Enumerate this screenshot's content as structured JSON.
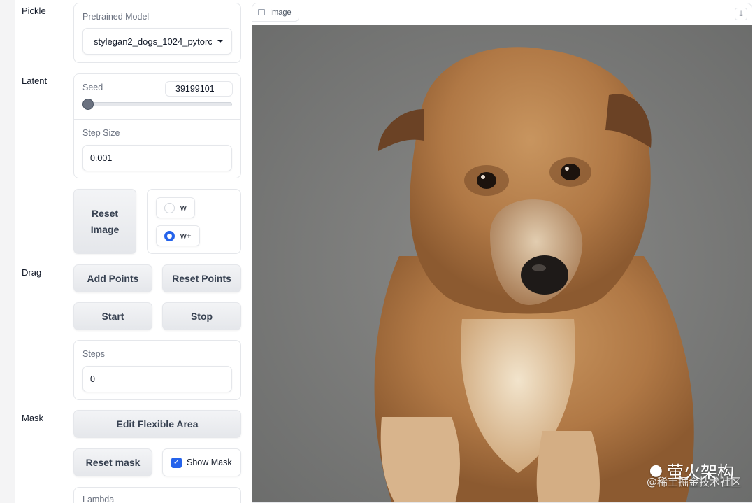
{
  "sections": {
    "pickle": "Pickle",
    "latent": "Latent",
    "drag": "Drag",
    "mask": "Mask"
  },
  "pretrained_model": {
    "label": "Pretrained Model",
    "value": "stylegan2_dogs_1024_pytorc"
  },
  "seed": {
    "label": "Seed",
    "value": "39199101",
    "slider_fraction": 0.0
  },
  "step_size": {
    "label": "Step Size",
    "value": "0.001"
  },
  "reset_image_label": "Reset Image",
  "latent_space": {
    "options": [
      "w",
      "w+"
    ],
    "selected": "w+"
  },
  "drag": {
    "add_points": "Add Points",
    "reset_points": "Reset Points",
    "start": "Start",
    "stop": "Stop"
  },
  "steps": {
    "label": "Steps",
    "value": "0"
  },
  "mask": {
    "edit_flexible_area": "Edit Flexible Area",
    "reset_mask": "Reset mask",
    "show_mask_label": "Show Mask",
    "show_mask_checked": true
  },
  "lambda_label": "Lambda",
  "image_panel": {
    "label": "Image",
    "icon": "image-icon",
    "download_icon": "download-icon"
  },
  "watermark": {
    "brand": "萤火架构",
    "sub": "@稀土掘金技术社区"
  },
  "colors": {
    "accent": "#2563eb",
    "button_bg": "#f3f4f6",
    "border": "#e5e7eb"
  }
}
